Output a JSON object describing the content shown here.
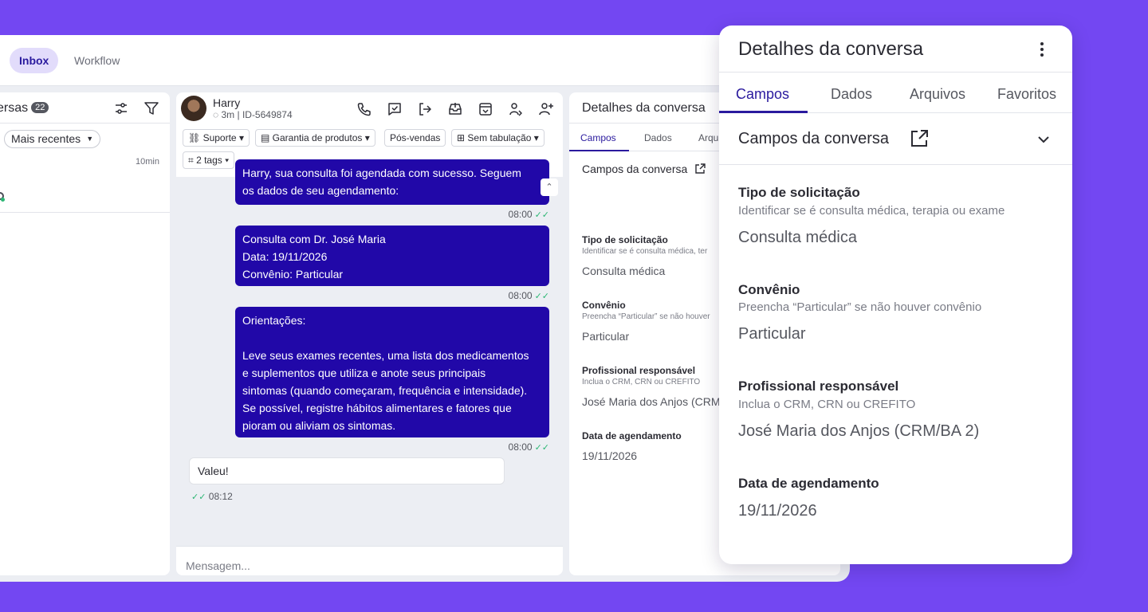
{
  "app": {
    "nav_tabs": [
      {
        "label": "Inbox",
        "active": true
      },
      {
        "label": "Workflow",
        "active": false
      }
    ]
  },
  "conversation_list": {
    "title": "ersas",
    "count": "22",
    "sort_label": "Mais recentes",
    "item_time": "10min"
  },
  "chat": {
    "contact_name": "Harry",
    "contact_meta": "3m | ID-5649874",
    "chips": {
      "team": "Suporte",
      "queue": "Garantia de produtos",
      "category": "Pós-vendas",
      "tabulation": "Sem tabulação",
      "tags": "2 tags"
    },
    "messages": [
      {
        "direction": "out",
        "text": "Harry, sua consulta foi agendada com sucesso. Seguem\nos dados de seu agendamento:",
        "time": "08:00"
      },
      {
        "direction": "out",
        "text": "Consulta com Dr. José Maria\nData: 19/11/2026\nConvênio: Particular",
        "time": "08:00"
      },
      {
        "direction": "out",
        "text": "Orientações:\n\nLeve seus exames recentes, uma lista dos medicamentos\ne suplementos que utiliza e anote seus principais\nsintomas (quando começaram, frequência e intensidade).\nSe possível, registre hábitos alimentares e fatores que\npioram ou aliviam os sintomas.",
        "time": "08:00"
      },
      {
        "direction": "in",
        "text": "Valeu!",
        "time": "08:12"
      }
    ],
    "composer_placeholder": "Mensagem..."
  },
  "details_panel": {
    "title": "Detalhes da conversa",
    "tabs": [
      "Campos",
      "Dados",
      "Arqu"
    ],
    "section": "Campos da conversa",
    "fields": [
      {
        "label": "Tipo de solicitação",
        "hint": "Identificar se é consulta médica, ter",
        "value": "Consulta médica"
      },
      {
        "label": "Convênio",
        "hint": "Preencha “Particular” se não houver",
        "value": "Particular"
      },
      {
        "label": "Profissional responsável",
        "hint": "Inclua o CRM, CRN ou CREFITO",
        "value": "José Maria dos Anjos (CRM"
      },
      {
        "label": "Data de agendamento",
        "hint": "",
        "value": "19/11/2026"
      }
    ]
  },
  "zoom_card": {
    "title": "Detalhes da conversa",
    "tabs": [
      "Campos",
      "Dados",
      "Arquivos",
      "Favoritos"
    ],
    "active_tab": "Campos",
    "section": "Campos da conversa",
    "fields": [
      {
        "label": "Tipo de solicitação",
        "hint": "Identificar se é consulta médica, terapia ou exame",
        "value": "Consulta médica"
      },
      {
        "label": "Convênio",
        "hint": "Preencha “Particular” se não houver convênio",
        "value": "Particular"
      },
      {
        "label": "Profissional responsável",
        "hint": "Inclua o CRM, CRN ou CREFITO",
        "value": "José Maria dos Anjos (CRM/BA 2)"
      },
      {
        "label": "Data de agendamento",
        "hint": "",
        "value": "19/11/2026"
      }
    ]
  },
  "colors": {
    "background": "#7347F2",
    "accent": "#2a1a9e",
    "outgoing_bubble": "#2108A8",
    "read_tick": "#2bb673"
  }
}
